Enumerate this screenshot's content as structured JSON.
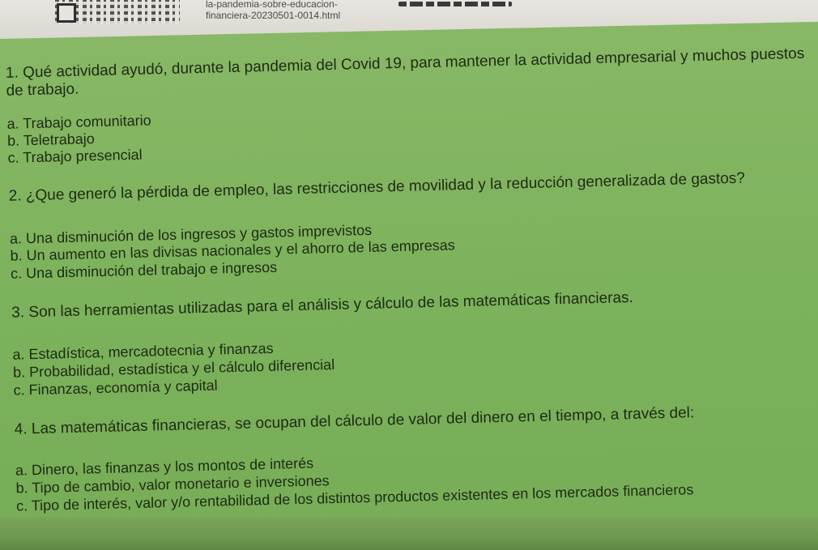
{
  "header": {
    "url_line1": "la-pandemia-sobre-educacion-",
    "url_line2": "financiera-20230501-0014.html"
  },
  "questions": [
    {
      "lines": [
        "1. Qué actividad ayudó, durante la pandemia del Covid 19, para mantener la actividad empresarial y muchos puestos",
        "de trabajo."
      ],
      "options": [
        "a. Trabajo comunitario",
        "b. Teletrabajo",
        "c. Trabajo presencial"
      ]
    },
    {
      "lines": [
        "2. ¿Que generó la pérdida de empleo, las restricciones de movilidad y la reducción generalizada de gastos?"
      ],
      "options": [
        "a. Una disminución de los ingresos y gastos imprevistos",
        "b. Un aumento en las divisas nacionales y el ahorro de las empresas",
        "c. Una disminución del trabajo e ingresos"
      ]
    },
    {
      "lines": [
        "3. Son las herramientas utilizadas para el análisis y cálculo de las matemáticas financieras."
      ],
      "options": [
        "a. Estadística, mercadotecnia y finanzas",
        "b. Probabilidad, estadística y el cálculo diferencial",
        "c. Finanzas, economía y capital"
      ]
    },
    {
      "lines": [
        "4. Las matemáticas financieras, se ocupan del cálculo de valor del dinero en el tiempo, a través del:"
      ],
      "options": [
        "a. Dinero, las finanzas y los montos de interés",
        "b. Tipo de cambio, valor monetario e inversiones",
        "c. Tipo de interés, valor y/o rentabilidad de los distintos productos existentes en los mercados financieros"
      ]
    }
  ]
}
